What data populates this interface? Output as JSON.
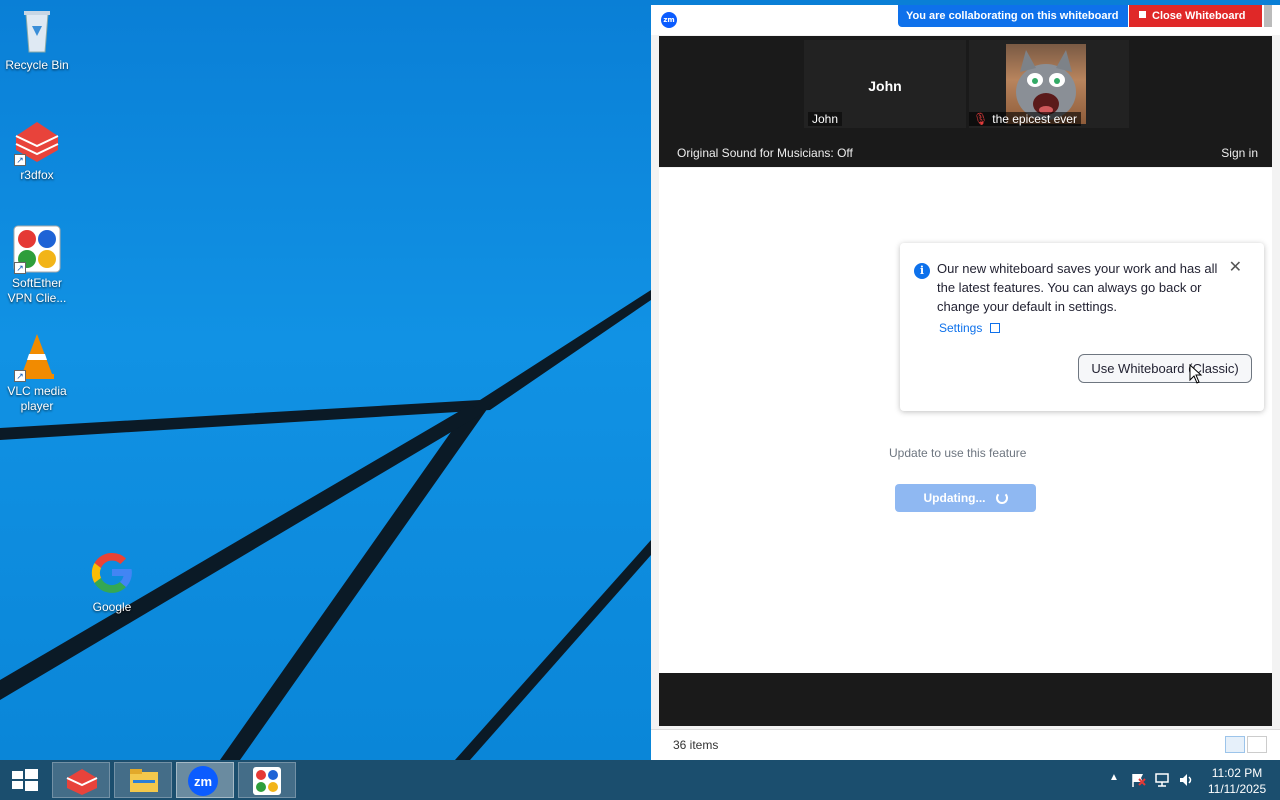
{
  "desktop": {
    "icons": [
      {
        "label": "Recycle Bin",
        "icon": "recycle-bin-icon"
      },
      {
        "label": "r3dfox",
        "icon": "r3dfox-icon"
      },
      {
        "label": "SoftEther VPN Clie...",
        "icon": "softether-vpn-icon"
      },
      {
        "label": "VLC media player",
        "icon": "vlc-icon"
      },
      {
        "label": "Google",
        "icon": "google-icon"
      }
    ]
  },
  "zoom": {
    "logo": "zm",
    "collab_banner": "You are collaborating on this whiteboard",
    "close_whiteboard": "Close Whiteboard",
    "participants": [
      {
        "display": "John",
        "label": "John"
      },
      {
        "label": "the epicest ever",
        "muted": true
      }
    ],
    "original_sound": "Original Sound for Musicians: Off",
    "sign_in": "Sign in",
    "popup": {
      "message": "Our new whiteboard saves your work and has all the latest features. You can always go back or change your default in settings.",
      "settings_link": "Settings",
      "use_classic": "Use Whiteboard (Classic)"
    },
    "update_text": "Update to use this feature",
    "updating_button": "Updating...",
    "status_items": "36 items"
  },
  "colors": {
    "zoom_blue": "#0e71eb",
    "close_red": "#e02828",
    "taskbar": "#1b4e6e"
  },
  "taskbar": {
    "apps": [
      "r3dfox-icon",
      "file-explorer-icon",
      "zoom-icon",
      "softether-vpn-icon"
    ],
    "clock_time": "11:02 PM",
    "clock_date": "11/11/2025"
  }
}
